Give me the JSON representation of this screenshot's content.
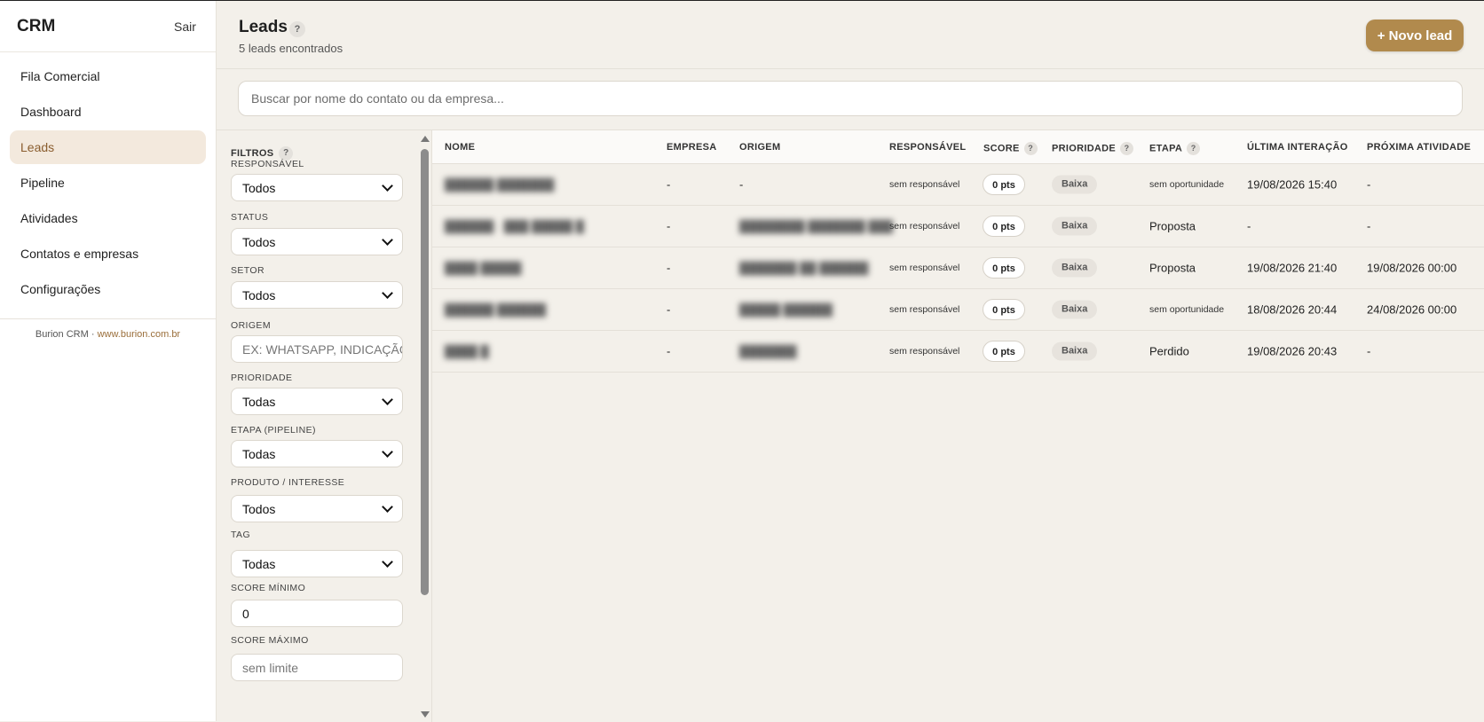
{
  "sidebar": {
    "brand": "CRM",
    "logout": "Sair",
    "items": [
      {
        "label": "Fila Comercial"
      },
      {
        "label": "Dashboard"
      },
      {
        "label": "Leads"
      },
      {
        "label": "Pipeline"
      },
      {
        "label": "Atividades"
      },
      {
        "label": "Contatos e empresas"
      },
      {
        "label": "Configurações"
      }
    ],
    "footer_text": "Burion CRM · ",
    "footer_link": "www.burion.com.br"
  },
  "header": {
    "title": "Leads",
    "help": "?",
    "subtitle": "5 leads encontrados",
    "new_button": "+ Novo lead"
  },
  "search": {
    "placeholder": "Buscar por nome do contato ou da empresa..."
  },
  "filters": {
    "title": "FILTROS",
    "help": "?",
    "fields": [
      {
        "label": "RESPONSÁVEL",
        "value": "Todos"
      },
      {
        "label": "STATUS",
        "value": "Todos"
      },
      {
        "label": "SETOR",
        "value": "Todos"
      },
      {
        "label": "ORIGEM",
        "placeholder": "EX: WHATSAPP, INDICAÇÃO"
      },
      {
        "label": "PRIORIDADE",
        "value": "Todas"
      },
      {
        "label": "ETAPA (PIPELINE)",
        "value": "Todas"
      },
      {
        "label": "PRODUTO / INTERESSE",
        "value": "Todos"
      },
      {
        "label": "TAG",
        "value": "Todas"
      },
      {
        "label": "SCORE MÍNIMO",
        "value": "0"
      },
      {
        "label": "SCORE MÁXIMO",
        "placeholder": "sem limite"
      }
    ]
  },
  "table": {
    "columns": [
      "NOME",
      "EMPRESA",
      "ORIGEM",
      "RESPONSÁVEL",
      "SCORE",
      "PRIORIDADE",
      "ETAPA",
      "ÚLTIMA INTERAÇÃO",
      "PRÓXIMA ATIVIDADE"
    ],
    "help": "?",
    "rows": [
      {
        "nome": "██████ ███████",
        "empresa": "-",
        "origem": "-",
        "responsavel": "sem responsável",
        "score": "0 pts",
        "prioridade": "Baixa",
        "etapa": "sem oportunidade",
        "ultima": "19/08/2026 15:40",
        "proxima": "-"
      },
      {
        "nome": "██████ · ███ █████ █",
        "empresa": "-",
        "origem": "████████ ███████ ███",
        "responsavel": "sem responsável",
        "score": "0 pts",
        "prioridade": "Baixa",
        "etapa": "Proposta",
        "ultima": "-",
        "proxima": "-"
      },
      {
        "nome": "████ █████",
        "empresa": "-",
        "origem": "███████ ██ ██████",
        "responsavel": "sem responsável",
        "score": "0 pts",
        "prioridade": "Baixa",
        "etapa": "Proposta",
        "ultima": "19/08/2026 21:40",
        "proxima": "19/08/2026 00:00"
      },
      {
        "nome": "██████ ██████",
        "empresa": "-",
        "origem": "█████ ██████",
        "responsavel": "sem responsável",
        "score": "0 pts",
        "prioridade": "Baixa",
        "etapa": "sem oportunidade",
        "ultima": "18/08/2026 20:44",
        "proxima": "24/08/2026 00:00"
      },
      {
        "nome": "████ █",
        "empresa": "-",
        "origem": "███████",
        "responsavel": "sem responsável",
        "score": "0 pts",
        "prioridade": "Baixa",
        "etapa": "Perdido",
        "ultima": "19/08/2026 20:43",
        "proxima": "-"
      }
    ]
  }
}
